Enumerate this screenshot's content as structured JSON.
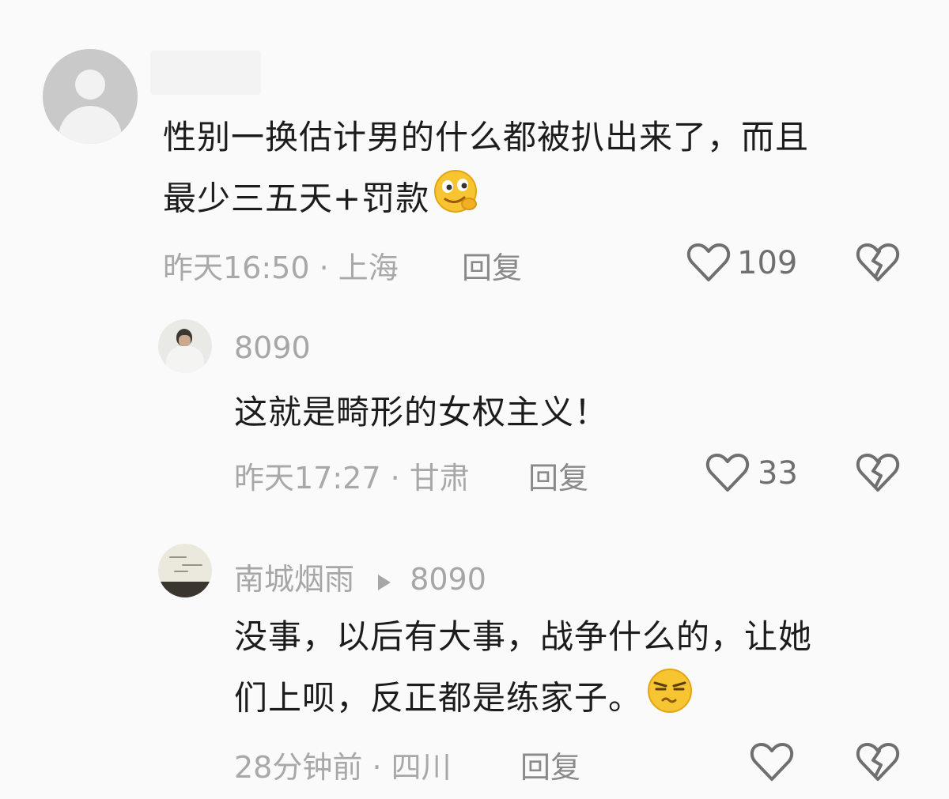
{
  "comments": [
    {
      "username": "",
      "text_line1": "性别一换估计男的什么都被扒出来了，而且",
      "text_line2": "最少三五天+罚款",
      "emoji": "smirk-emoji",
      "time": "昨天16:50",
      "location": "上海",
      "reply_label": "回复",
      "likes": "109"
    },
    {
      "username": "8090",
      "text": "这就是畸形的女权主义！",
      "time": "昨天17:27",
      "location": "甘肃",
      "reply_label": "回复",
      "likes": "33"
    },
    {
      "username": "南城烟雨",
      "reply_to": "8090",
      "text_line1": "没事，以后有大事，战争什么的，让她",
      "text_line2": "们上呗，反正都是练家子。",
      "emoji": "squint-emoji",
      "time": "28分钟前",
      "location": "四川",
      "reply_label": "回复",
      "likes": ""
    }
  ],
  "separator": "·",
  "icons": {
    "like": "heart-outline-icon",
    "dislike": "broken-heart-icon",
    "reply_arrow": "play-triangle-icon"
  },
  "colors": {
    "background": "#fafafa",
    "text": "#1c1c1c",
    "meta": "#a8a8a8",
    "emoji_yellow": "#f7c531"
  }
}
